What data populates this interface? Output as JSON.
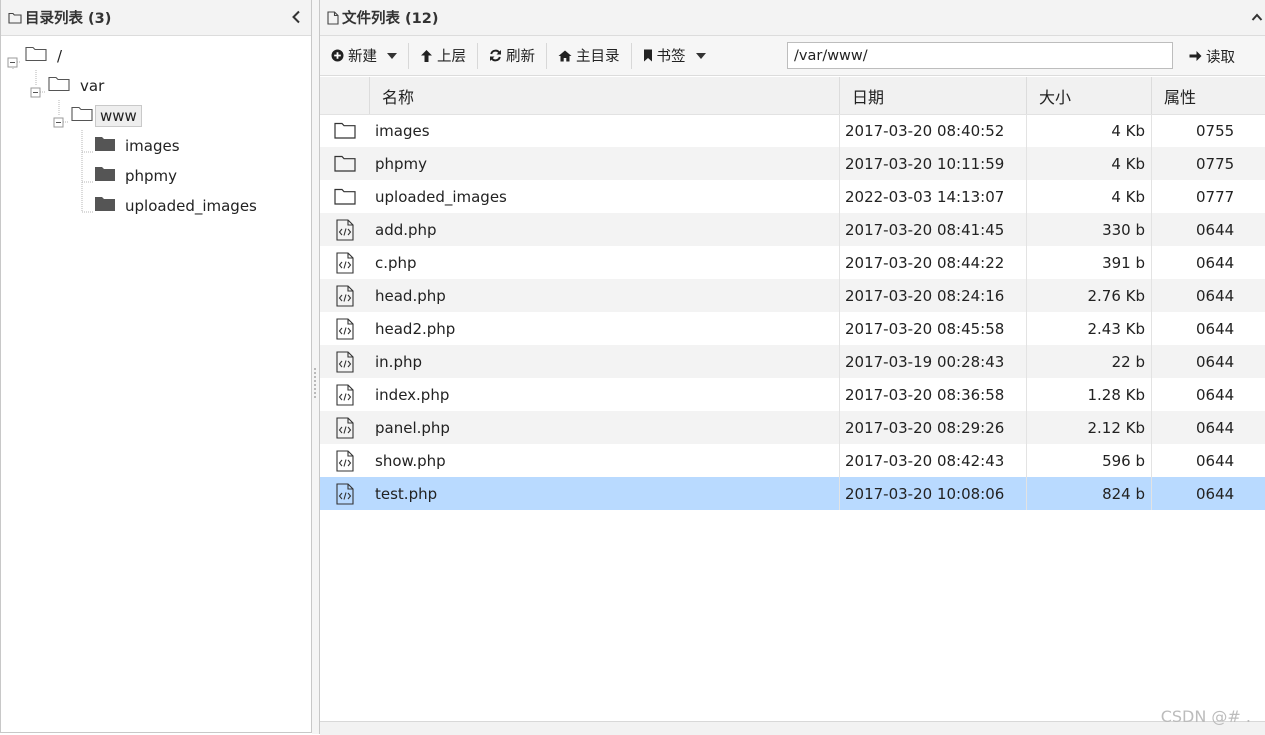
{
  "tree_panel": {
    "title": "目录列表 (3)",
    "nodes": [
      {
        "label": "/"
      },
      {
        "label": "var"
      },
      {
        "label": "www"
      },
      {
        "label": "images"
      },
      {
        "label": "phpmy"
      },
      {
        "label": "uploaded_images"
      }
    ]
  },
  "file_panel": {
    "title": "文件列表 (12)",
    "toolbar": {
      "new_label": "新建",
      "up_label": "上层",
      "refresh_label": "刷新",
      "home_label": "主目录",
      "bookmark_label": "书签",
      "path_value": "/var/www/",
      "read_label": "读取"
    },
    "columns": {
      "name": "名称",
      "date": "日期",
      "size": "大小",
      "attr": "属性"
    },
    "files": [
      {
        "icon": "folder-icon",
        "name": "images",
        "date": "2017-03-20 08:40:52",
        "size": "4 Kb",
        "attr": "0755"
      },
      {
        "icon": "folder-icon",
        "name": "phpmy",
        "date": "2017-03-20 10:11:59",
        "size": "4 Kb",
        "attr": "0775"
      },
      {
        "icon": "folder-icon",
        "name": "uploaded_images",
        "date": "2022-03-03 14:13:07",
        "size": "4 Kb",
        "attr": "0777"
      },
      {
        "icon": "code-file-icon",
        "name": "add.php",
        "date": "2017-03-20 08:41:45",
        "size": "330 b",
        "attr": "0644"
      },
      {
        "icon": "code-file-icon",
        "name": "c.php",
        "date": "2017-03-20 08:44:22",
        "size": "391 b",
        "attr": "0644"
      },
      {
        "icon": "code-file-icon",
        "name": "head.php",
        "date": "2017-03-20 08:24:16",
        "size": "2.76 Kb",
        "attr": "0644"
      },
      {
        "icon": "code-file-icon",
        "name": "head2.php",
        "date": "2017-03-20 08:45:58",
        "size": "2.43 Kb",
        "attr": "0644"
      },
      {
        "icon": "code-file-icon",
        "name": "in.php",
        "date": "2017-03-19 00:28:43",
        "size": "22 b",
        "attr": "0644"
      },
      {
        "icon": "code-file-icon",
        "name": "index.php",
        "date": "2017-03-20 08:36:58",
        "size": "1.28 Kb",
        "attr": "0644"
      },
      {
        "icon": "code-file-icon",
        "name": "panel.php",
        "date": "2017-03-20 08:29:26",
        "size": "2.12 Kb",
        "attr": "0644"
      },
      {
        "icon": "code-file-icon",
        "name": "show.php",
        "date": "2017-03-20 08:42:43",
        "size": "596 b",
        "attr": "0644"
      },
      {
        "icon": "code-file-icon",
        "name": "test.php",
        "date": "2017-03-20 10:08:06",
        "size": "824 b",
        "attr": "0644"
      }
    ],
    "selected_file": "test.php"
  },
  "watermark": "CSDN @# ."
}
